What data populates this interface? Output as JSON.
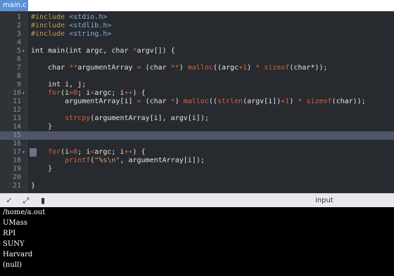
{
  "tabs": [
    {
      "label": "main.c"
    }
  ],
  "panel": {
    "title": "input"
  },
  "code_lines": [
    {
      "n": "1",
      "tokens": [
        {
          "t": "pp",
          "v": "#include "
        },
        {
          "t": "hdr",
          "v": "<stdio.h>"
        }
      ]
    },
    {
      "n": "2",
      "tokens": [
        {
          "t": "pp",
          "v": "#include "
        },
        {
          "t": "hdr",
          "v": "<stdlib.h>"
        }
      ]
    },
    {
      "n": "3",
      "tokens": [
        {
          "t": "pp",
          "v": "#include "
        },
        {
          "t": "hdr",
          "v": "<string.h>"
        }
      ]
    },
    {
      "n": "4",
      "tokens": []
    },
    {
      "n": "5",
      "fold": true,
      "tokens": [
        {
          "t": "kw",
          "v": "int main(int argc, char "
        },
        {
          "t": "op",
          "v": "*"
        },
        {
          "t": "kw",
          "v": "argv[]) {"
        }
      ]
    },
    {
      "n": "6",
      "tokens": []
    },
    {
      "n": "7",
      "tokens": [
        {
          "t": "kw",
          "v": "    char "
        },
        {
          "t": "op",
          "v": "**"
        },
        {
          "t": "kw",
          "v": "argumentArray "
        },
        {
          "t": "op",
          "v": "="
        },
        {
          "t": "kw",
          "v": " (char "
        },
        {
          "t": "op",
          "v": "**"
        },
        {
          "t": "kw",
          "v": ") "
        },
        {
          "t": "fn",
          "v": "malloc"
        },
        {
          "t": "kw",
          "v": "((argc"
        },
        {
          "t": "op",
          "v": "+1"
        },
        {
          "t": "kw",
          "v": ") "
        },
        {
          "t": "op",
          "v": "*"
        },
        {
          "t": "kw",
          "v": " "
        },
        {
          "t": "fn",
          "v": "sizeof"
        },
        {
          "t": "kw",
          "v": "(char*));"
        }
      ]
    },
    {
      "n": "8",
      "tokens": []
    },
    {
      "n": "9",
      "tokens": [
        {
          "t": "kw",
          "v": "    int i, j;"
        }
      ]
    },
    {
      "n": "10",
      "fold": true,
      "tokens": [
        {
          "t": "fn",
          "v": "    for"
        },
        {
          "t": "kw",
          "v": "(i"
        },
        {
          "t": "op",
          "v": "=0"
        },
        {
          "t": "kw",
          "v": "; i"
        },
        {
          "t": "op",
          "v": "<"
        },
        {
          "t": "kw",
          "v": "argc; i"
        },
        {
          "t": "op",
          "v": "++"
        },
        {
          "t": "kw",
          "v": ") {"
        }
      ]
    },
    {
      "n": "11",
      "tokens": [
        {
          "t": "kw",
          "v": "        argumentArray[i] "
        },
        {
          "t": "op",
          "v": "="
        },
        {
          "t": "kw",
          "v": " (char "
        },
        {
          "t": "op",
          "v": "*"
        },
        {
          "t": "kw",
          "v": ") "
        },
        {
          "t": "fn",
          "v": "malloc"
        },
        {
          "t": "kw",
          "v": "(("
        },
        {
          "t": "fn",
          "v": "strlen"
        },
        {
          "t": "kw",
          "v": "(argv[i])"
        },
        {
          "t": "op",
          "v": "+1"
        },
        {
          "t": "kw",
          "v": ") "
        },
        {
          "t": "op",
          "v": "*"
        },
        {
          "t": "kw",
          "v": " "
        },
        {
          "t": "fn",
          "v": "sizeof"
        },
        {
          "t": "kw",
          "v": "(char));"
        }
      ]
    },
    {
      "n": "12",
      "tokens": []
    },
    {
      "n": "13",
      "tokens": [
        {
          "t": "fn",
          "v": "        strcpy"
        },
        {
          "t": "kw",
          "v": "(argumentArray[i], argv[i]);"
        }
      ]
    },
    {
      "n": "14",
      "tokens": [
        {
          "t": "kw",
          "v": "    }"
        }
      ]
    },
    {
      "n": "15",
      "hl": true,
      "tokens": []
    },
    {
      "n": "16",
      "tokens": []
    },
    {
      "n": "17",
      "fold": true,
      "tokens": [
        {
          "t": "fn",
          "v": "    for"
        },
        {
          "t": "kw",
          "v": "(i"
        },
        {
          "t": "op",
          "v": "=0"
        },
        {
          "t": "kw",
          "v": "; i"
        },
        {
          "t": "op",
          "v": "<"
        },
        {
          "t": "kw",
          "v": "argc; i"
        },
        {
          "t": "op",
          "v": "++"
        },
        {
          "t": "kw",
          "v": ") {"
        }
      ]
    },
    {
      "n": "18",
      "tokens": [
        {
          "t": "fn",
          "v": "        printf"
        },
        {
          "t": "kw",
          "v": "("
        },
        {
          "t": "str",
          "v": "\"%s\\n\""
        },
        {
          "t": "kw",
          "v": ", argumentArray[i]);"
        }
      ]
    },
    {
      "n": "19",
      "tokens": [
        {
          "t": "kw",
          "v": "    }"
        }
      ]
    },
    {
      "n": "20",
      "tokens": []
    },
    {
      "n": "21",
      "tokens": [
        {
          "t": "kw",
          "v": "}"
        }
      ]
    }
  ],
  "console_lines": [
    "/home/a.out",
    "UMass",
    "RPI",
    "SUNY",
    "Harvard",
    "(null)"
  ],
  "icons": {
    "collapse": "chevron-down-icon",
    "expand": "expand-arrows-icon",
    "clear": "clear-console-icon"
  }
}
